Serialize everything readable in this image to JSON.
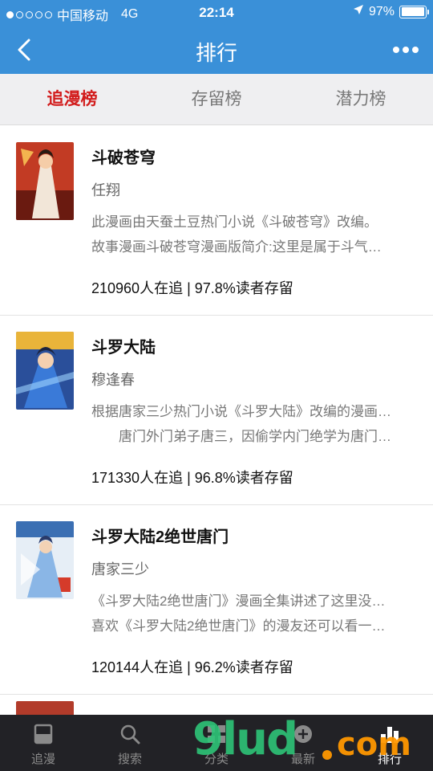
{
  "status_bar": {
    "carrier": "中国移动",
    "network": "4G",
    "time": "22:14",
    "battery_text": "97%",
    "battery_level": 0.97,
    "signal_bars_filled": 1,
    "signal_bars_total": 5
  },
  "nav": {
    "title": "排行",
    "back_icon": "chevron-left-icon",
    "more_icon": "more-dots-icon"
  },
  "tabs": [
    {
      "label": "追漫榜",
      "active": true
    },
    {
      "label": "存留榜",
      "active": false
    },
    {
      "label": "潜力榜",
      "active": false
    }
  ],
  "items": [
    {
      "title": "斗破苍穹",
      "author": "任翔",
      "desc_line1": "此漫画由天蚕土豆热门小说《斗破苍穹》改编。",
      "desc_line2": "故事漫画斗破苍穹漫画版简介:这里是属于斗气…",
      "stats": "210960人在追 | 97.8%读者存留"
    },
    {
      "title": "斗罗大陆",
      "author": "穆逢春",
      "desc_line1": "根据唐家三少热门小说《斗罗大陆》改编的漫画…",
      "desc_line2": "　　唐门外门弟子唐三，因偷学内门绝学为唐门…",
      "stats": "171330人在追 | 96.8%读者存留"
    },
    {
      "title": "斗罗大陆2绝世唐门",
      "author": "唐家三少",
      "desc_line1": "《斗罗大陆2绝世唐门》漫画全集讲述了这里没…",
      "desc_line2": "喜欢《斗罗大陆2绝世唐门》的漫友还可以看一…",
      "stats": "120144人在追 | 96.2%读者存留"
    }
  ],
  "bottom_tabs": [
    {
      "label": "追漫",
      "icon": "bookmark-icon",
      "active": false
    },
    {
      "label": "搜索",
      "icon": "search-icon",
      "active": false
    },
    {
      "label": "分类",
      "icon": "grid-icon",
      "active": false
    },
    {
      "label": "最新",
      "icon": "new-icon",
      "active": false
    },
    {
      "label": "排行",
      "icon": "ranking-icon",
      "active": true
    }
  ],
  "watermark": {
    "text": "9lud",
    "suffix": "com"
  },
  "colors": {
    "primary": "#3a90d8",
    "active_tab": "#d21c1c",
    "bottom_bar": "#222226"
  }
}
